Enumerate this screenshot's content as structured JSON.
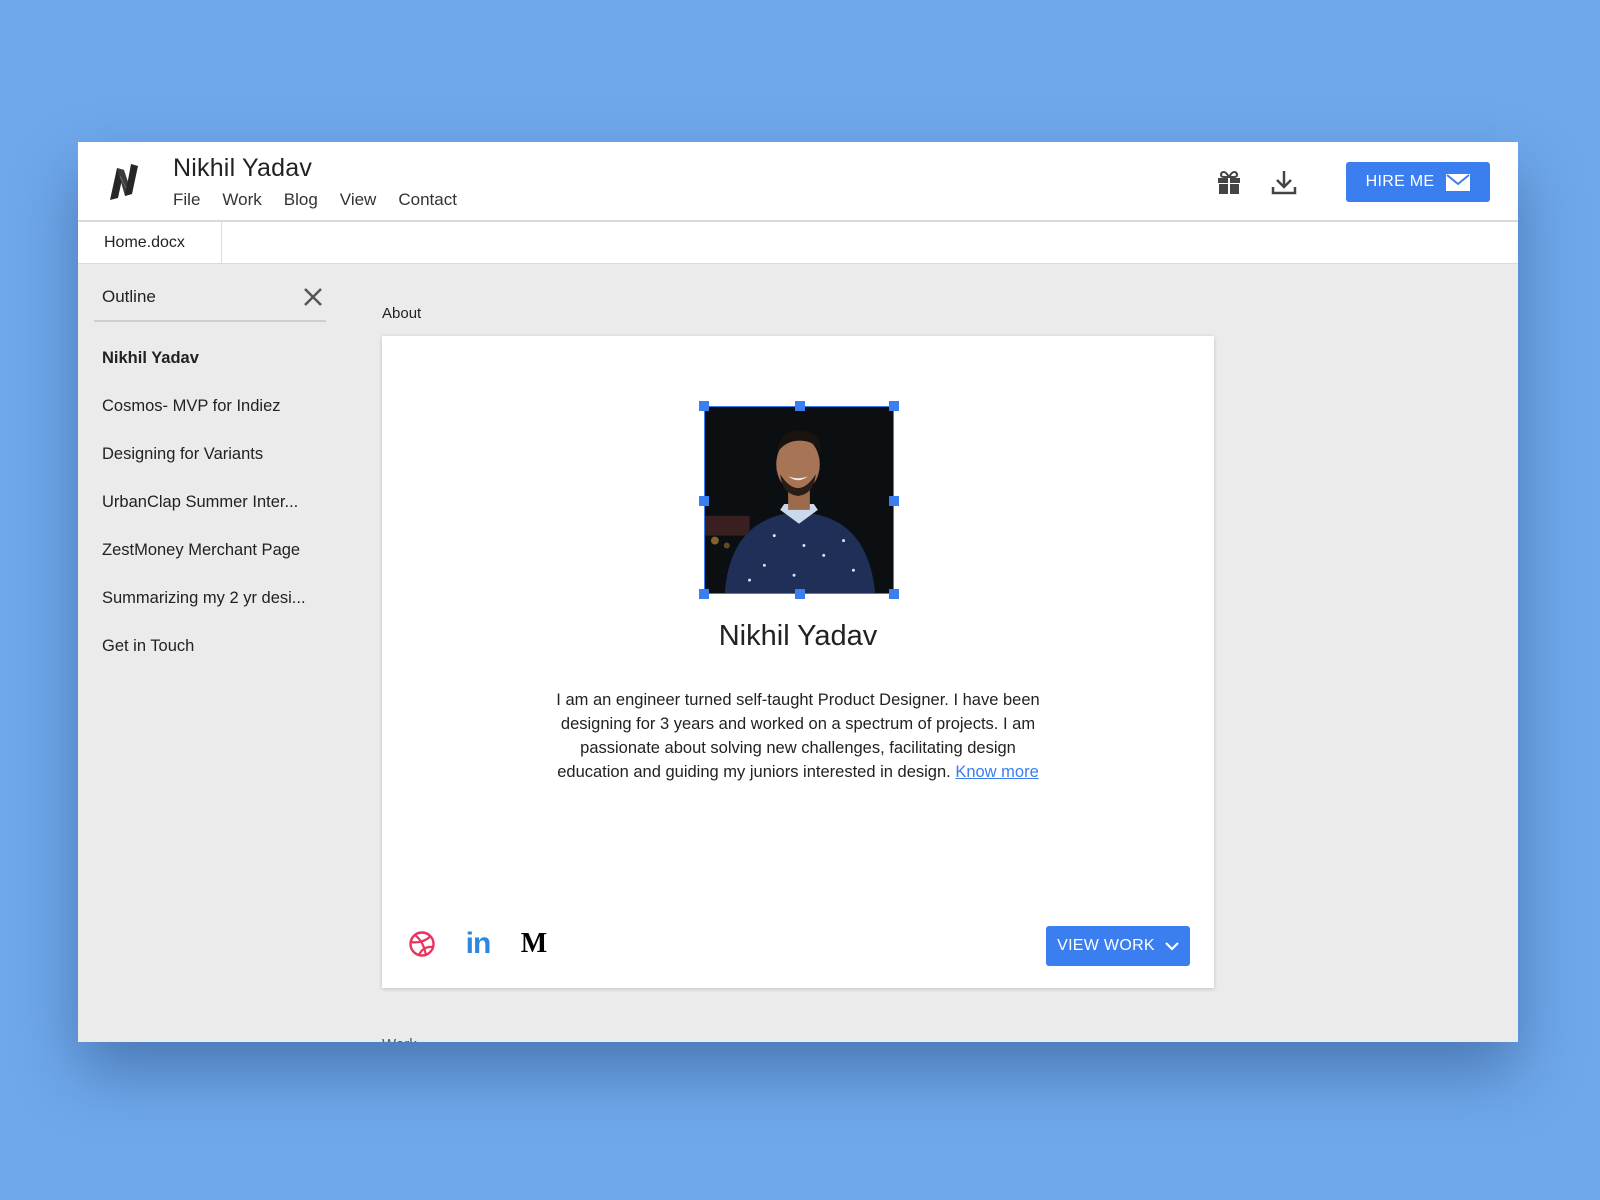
{
  "header": {
    "logo": "n-logo-icon",
    "title": "Nikhil Yadav",
    "menu": [
      "File",
      "Work",
      "Blog",
      "View",
      "Contact"
    ],
    "actions": {
      "gift_icon": "gift-icon",
      "download_icon": "download-icon",
      "hire_label": "HIRE ME",
      "hire_icon": "mail-icon"
    }
  },
  "tabs": [
    {
      "label": "Home.docx",
      "active": true
    }
  ],
  "outline": {
    "title": "Outline",
    "close_icon": "close-icon",
    "items": [
      {
        "label": "Nikhil Yadav",
        "active": true
      },
      {
        "label": "Cosmos- MVP for Indiez",
        "active": false
      },
      {
        "label": "Designing for Variants",
        "active": false
      },
      {
        "label": "UrbanClap Summer Inter...",
        "active": false
      },
      {
        "label": "ZestMoney Merchant Page",
        "active": false
      },
      {
        "label": "Summarizing my 2 yr desi...",
        "active": false
      },
      {
        "label": "Get in Touch",
        "active": false
      }
    ]
  },
  "document": {
    "section_label": "About",
    "next_section_label": "Work",
    "profile": {
      "photo_alt": "Portrait of Nikhil Yadav",
      "name": "Nikhil Yadav",
      "bio": "I am an engineer turned self-taught Product Designer. I have been designing for 3 years and worked on a spectrum of projects. I am passionate about solving new challenges, facilitating design education and guiding my juniors interested in design.",
      "know_more": "Know more"
    },
    "socials": [
      {
        "name": "dribbble",
        "icon": "dribbble-icon",
        "color": "#e8345f"
      },
      {
        "name": "linkedin",
        "icon": "linkedin-icon",
        "glyph": "in",
        "color": "#2f86e0"
      },
      {
        "name": "medium",
        "icon": "medium-icon",
        "glyph": "M",
        "color": "#000000"
      }
    ],
    "view_work_label": "VIEW WORK"
  },
  "colors": {
    "accent": "#3a7ef0",
    "background": "#6fa9ec",
    "canvas": "#ebebeb"
  }
}
